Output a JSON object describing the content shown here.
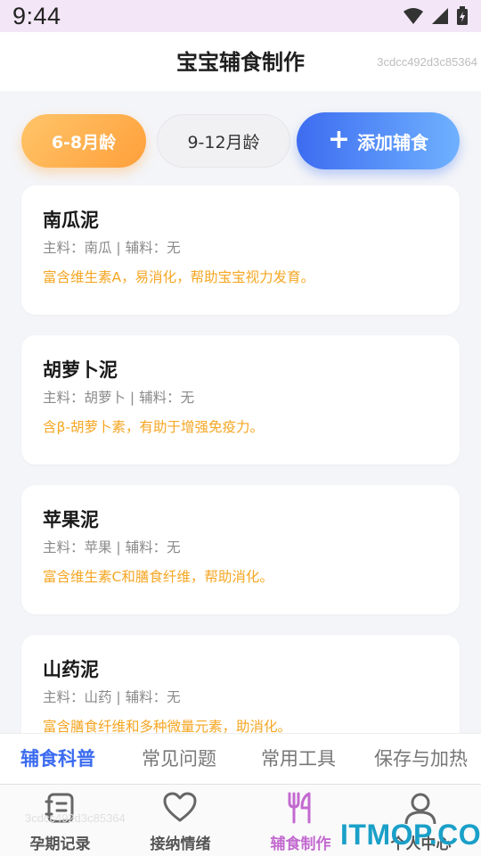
{
  "status_bar": {
    "time": "9:44",
    "icons": [
      "wifi-icon",
      "signal-icon",
      "battery-icon"
    ]
  },
  "header": {
    "title": "宝宝辅食制作",
    "id_text": "3cdcc492d3c85364"
  },
  "age_tabs": [
    {
      "label": "6-8月龄",
      "active": true
    },
    {
      "label": "9-12月龄",
      "active": false
    }
  ],
  "add_button": {
    "label": "添加辅食",
    "icon": "plus-icon"
  },
  "foods": [
    {
      "name": "南瓜泥",
      "ingredients": "主料：南瓜 | 辅料：无",
      "desc": "富含维生素A，易消化，帮助宝宝视力发育。"
    },
    {
      "name": "胡萝卜泥",
      "ingredients": "主料：胡萝卜 | 辅料：无",
      "desc": "含β-胡萝卜素，有助于增强免疫力。"
    },
    {
      "name": "苹果泥",
      "ingredients": "主料：苹果 | 辅料：无",
      "desc": "富含维生素C和膳食纤维，帮助消化。"
    },
    {
      "name": "山药泥",
      "ingredients": "主料：山药 | 辅料：无",
      "desc": "富含膳食纤维和多种微量元素，助消化。"
    }
  ],
  "category_tabs": [
    {
      "label": "辅食科普",
      "active": true
    },
    {
      "label": "常见问题",
      "active": false
    },
    {
      "label": "常用工具",
      "active": false
    },
    {
      "label": "保存与加热",
      "active": false
    }
  ],
  "bottom_nav": [
    {
      "label": "孕期记录",
      "icon": "notebook-icon",
      "active": false
    },
    {
      "label": "接纳情绪",
      "icon": "heart-icon",
      "active": false
    },
    {
      "label": "辅食制作",
      "icon": "utensils-icon",
      "active": true
    },
    {
      "label": "个人中心",
      "icon": "person-icon",
      "active": false
    }
  ],
  "colors": {
    "accent_blue": "#3b6bf0",
    "accent_orange": "#f5a623",
    "nav_active": "#c36ad0"
  },
  "watermark": "ITMOP.COM",
  "ghost_id": "3cdcc492d3c85364"
}
